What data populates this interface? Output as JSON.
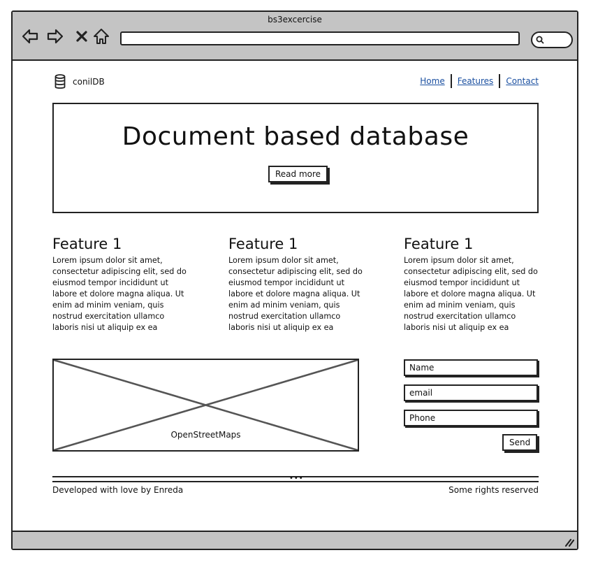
{
  "window": {
    "title": "bs3excercise"
  },
  "browser": {
    "back_icon": "arrow-left-icon",
    "forward_icon": "arrow-right-icon",
    "stop_icon": "close-icon",
    "home_icon": "home-icon",
    "search_icon": "search-icon",
    "address_value": ""
  },
  "header": {
    "brand_icon": "database-icon",
    "brand_name": "conilDB",
    "nav": [
      {
        "label": "Home"
      },
      {
        "label": "Features"
      },
      {
        "label": "Contact"
      }
    ],
    "link_color": "#1a4fa0"
  },
  "hero": {
    "title": "Document based database",
    "button_label": "Read more"
  },
  "features": [
    {
      "title": "Feature 1",
      "text": "Lorem ipsum dolor sit amet, consectetur adipiscing elit, sed do eiusmod tempor incididunt ut labore et dolore magna aliqua. Ut enim ad minim veniam, quis nostrud exercitation ullamco laboris nisi ut aliquip ex ea"
    },
    {
      "title": "Feature 1",
      "text": "Lorem ipsum dolor sit amet, consectetur adipiscing elit, sed do eiusmod tempor incididunt ut labore et dolore magna aliqua. Ut enim ad minim veniam, quis nostrud exercitation ullamco laboris nisi ut aliquip ex ea"
    },
    {
      "title": "Feature 1",
      "text": "Lorem ipsum dolor sit amet, consectetur adipiscing elit, sed do eiusmod tempor incididunt ut labore et dolore magna aliqua. Ut enim ad minim veniam, quis nostrud exercitation ullamco laboris nisi ut aliquip ex ea"
    }
  ],
  "map": {
    "label": "OpenStreetMaps"
  },
  "form": {
    "name_value": "Name",
    "email_value": "email",
    "phone_value": "Phone",
    "send_label": "Send"
  },
  "footer": {
    "left": "Developed with love by Enreda",
    "right": "Some rights reserved",
    "dots": "•••"
  },
  "colors": {
    "chrome": "#c4c4c4",
    "stroke": "#222222",
    "map_cross": "#555555"
  }
}
